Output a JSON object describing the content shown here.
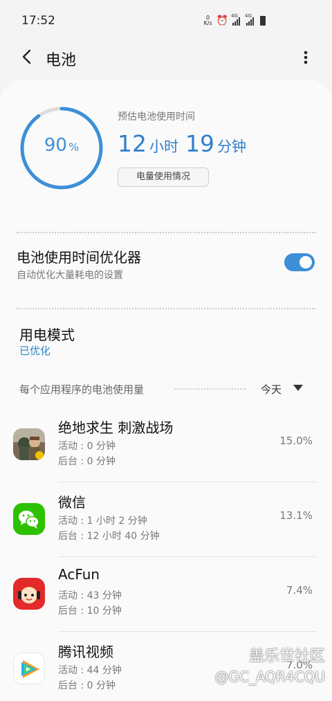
{
  "status_bar": {
    "time": "17:52",
    "net_speed_value": "0",
    "net_speed_unit": "K/s",
    "network_1": "4G",
    "network_2": "4G"
  },
  "app_bar": {
    "title": "电池"
  },
  "battery": {
    "percent": 90,
    "percent_sign": "%",
    "estimate_label": "预估电池使用时间",
    "hours": "12",
    "hours_unit": "小时",
    "minutes": "19",
    "minutes_unit": "分钟",
    "usage_button": "电量使用情况"
  },
  "optimizer": {
    "title": "电池使用时间优化器",
    "subtitle": "自动优化大量耗电的设置",
    "enabled": true
  },
  "power_mode": {
    "title": "用电模式",
    "value": "已优化"
  },
  "usage_section": {
    "header": "每个应用程序的电池使用量",
    "period": "今天"
  },
  "apps": [
    {
      "name": "绝地求生 刺激战场",
      "active": "活动 : 0 分钟",
      "background": "后台 : 0 分钟",
      "percent": "15.0%",
      "icon": "pubg-icon"
    },
    {
      "name": "微信",
      "active": "活动 : 1 小时 2 分钟",
      "background": "后台 : 12 小时 40 分钟",
      "percent": "13.1%",
      "icon": "wechat-icon"
    },
    {
      "name": "AcFun",
      "active": "活动 : 43 分钟",
      "background": "后台 : 10 分钟",
      "percent": "7.4%",
      "icon": "acfun-icon"
    },
    {
      "name": "腾讯视频",
      "active": "活动 : 44 分钟",
      "background": "后台 : 0 分钟",
      "percent": "7.0%",
      "icon": "tencent-video-icon"
    }
  ],
  "watermark": {
    "line1": "盖乐世社区",
    "line2": "@GC_AQR4CQU"
  },
  "colors": {
    "accent": "#3d8fd8",
    "link": "#2a86c6",
    "wechat": "#2dc100",
    "acfun": "#e32a2a"
  }
}
